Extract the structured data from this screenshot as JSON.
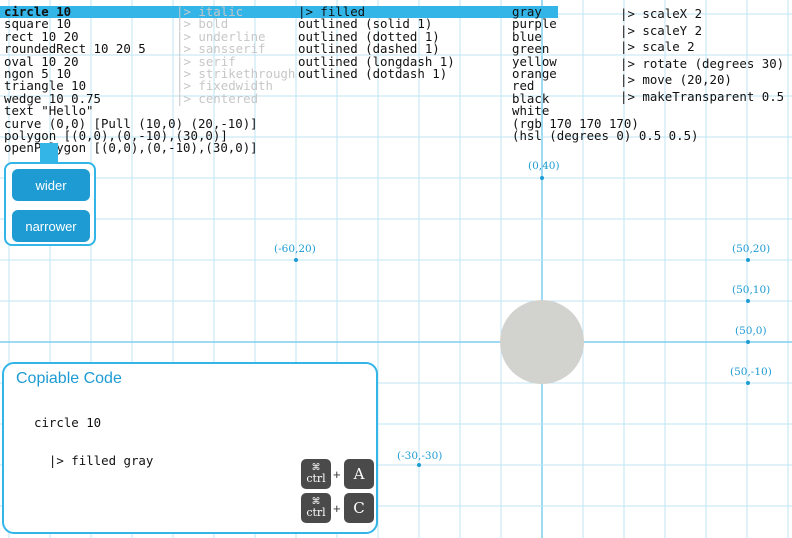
{
  "shapes": [
    "circle 10",
    "square 10",
    "rect 10 20",
    "roundedRect 10 20 5",
    "oval 10 20",
    "ngon 5 10",
    "triangle 10",
    "wedge 10 0.75",
    "text \"Hello\"",
    "curve (0,0) [Pull (10,0) (20,-10)]",
    "polygon [(0,0),(0,-10),(30,0)]",
    "openPolygon [(0,0),(0,-10),(30,0)]"
  ],
  "text_styles": [
    "|> italic",
    "|> bold",
    "|> underline",
    "|> sansserif",
    "|> serif",
    "|> strikethrough",
    "|> fixedwidth",
    "|> centered"
  ],
  "fills": [
    "|> filled",
    "outlined (solid 1)",
    "outlined (dotted 1)",
    "outlined (dashed 1)",
    "outlined (longdash 1)",
    "outlined (dotdash 1)"
  ],
  "colors": [
    "gray",
    "purple",
    "blue",
    "green",
    "yellow",
    "orange",
    "red",
    "black",
    "white",
    "(rgb 170 170 170)",
    "(hsl (degrees 0) 0.5 0.5)"
  ],
  "transforms": [
    "|> scaleX 2",
    "|> scaleY 2",
    "|> scale 2",
    "|> rotate (degrees 30)",
    "|> move (20,20)",
    "|> makeTransparent 0.5"
  ],
  "buttons": {
    "wider": "wider",
    "narrower": "narrower"
  },
  "copy": {
    "title": "Copiable Code",
    "line1": "circle 10",
    "line2": "  |> filled gray",
    "key_cmd_symbol": "⌘",
    "key_ctrl": "ctrl",
    "key_plus": "+",
    "key_a": "A",
    "key_c": "C"
  },
  "coords": {
    "c1": "(0,40)",
    "c2": "(-60,20)",
    "c3": "(50,20)",
    "c4": "(50,10)",
    "c5": "(50,0)",
    "c6": "(50,-10)",
    "c7": "(-30,-30)"
  },
  "colors_hex": {
    "accent": "#33b5e8",
    "button": "#1d9bd2",
    "grid": "#bfe6f6",
    "axis": "#7ecfee",
    "shape_fill": "#d2d3cf"
  }
}
